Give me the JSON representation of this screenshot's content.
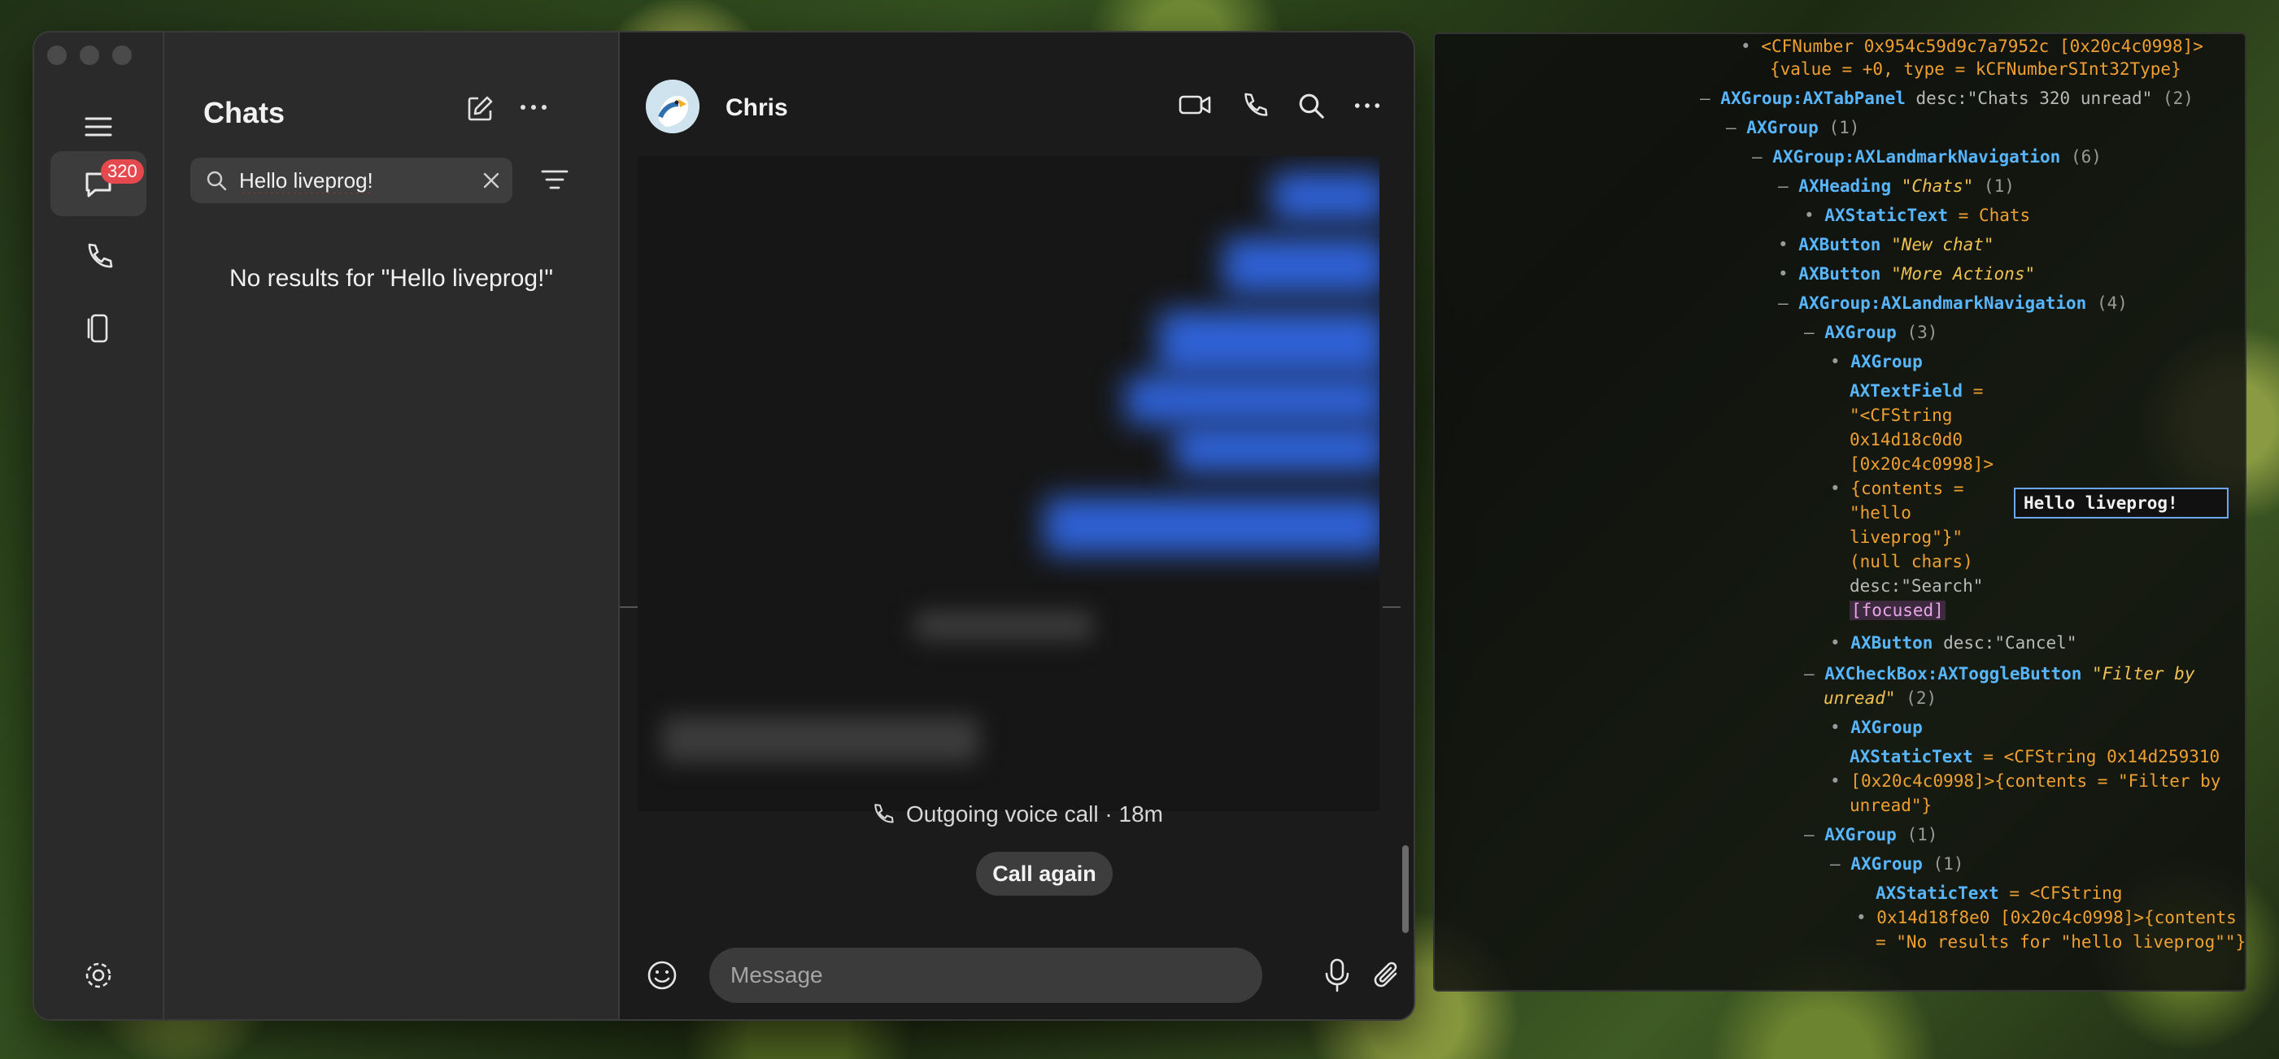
{
  "chat_app": {
    "sidebar_title": "Chats",
    "unread_badge": "320",
    "search": {
      "value": "Hello liveprog!",
      "placeholder": "Search"
    },
    "no_results": "No results for \"Hello liveprog!\"",
    "contact_name": "Chris",
    "call_info": "Outgoing voice call · 18m",
    "call_again": "Call again",
    "message_placeholder": "Message"
  },
  "inspector": {
    "lines": [
      {
        "text": "<CFNumber 0x954c59d9c7a7952c [0x20c4c0998]>"
      },
      {
        "text": "{value = +0, type = kCFNumberSInt32Type}"
      },
      {
        "role": "AXGroup:AXTabPanel",
        "extra": "desc:\"Chats 320 unread\"",
        "count": "(2)"
      },
      {
        "role": "AXGroup",
        "count": "(1)"
      },
      {
        "role": "AXGroup:AXLandmarkNavigation",
        "count": "(6)"
      },
      {
        "role": "AXHeading",
        "label": "\"Chats\"",
        "count": "(1)"
      },
      {
        "role": "AXStaticText",
        "extra": "= Chats"
      },
      {
        "role": "AXButton",
        "label": "\"New chat\""
      },
      {
        "role": "AXButton",
        "label": "\"More Actions\""
      },
      {
        "role": "AXGroup:AXLandmarkNavigation",
        "count": "(4)"
      },
      {
        "role": "AXGroup",
        "count": "(3)"
      },
      {
        "role": "AXGroup"
      },
      {
        "role": "AXTextField",
        "extra": "="
      },
      {
        "text": "\"<CFString"
      },
      {
        "text": "0x14d18c0d0"
      },
      {
        "text": "[0x20c4c0998]>"
      },
      {
        "text": "{contents ="
      },
      {
        "text": "\"hello"
      },
      {
        "text": "liveprog\"}\""
      },
      {
        "text": "(null chars)"
      },
      {
        "text": "desc:\"Search\""
      },
      {
        "text": "[focused]"
      },
      {
        "role": "AXButton",
        "extra": "desc:\"Cancel\""
      },
      {
        "role": "AXCheckBox:AXToggleButton",
        "label": "\"Filter by"
      },
      {
        "label": "unread\"",
        "count": "(2)"
      },
      {
        "role": "AXGroup"
      },
      {
        "role": "AXStaticText",
        "extra": "= <CFString 0x14d259310"
      },
      {
        "text": "[0x20c4c0998]>{contents = \"Filter by"
      },
      {
        "text": "unread\"}"
      },
      {
        "role": "AXGroup",
        "count": "(1)"
      },
      {
        "role": "AXGroup",
        "count": "(1)"
      },
      {
        "role": "AXStaticText",
        "extra": "= <CFString"
      },
      {
        "text": "0x14d18f8e0 [0x20c4c0998]>{contents"
      },
      {
        "text": "= \"No results for \"hello liveprog\"\"}"
      }
    ],
    "field_value": "Hello liveprog!"
  },
  "colors": {
    "accent_blue": "#2f62d6",
    "badge_red": "#e5484d",
    "role_blue": "#58b6ff",
    "value_orange": "#f0a030"
  }
}
